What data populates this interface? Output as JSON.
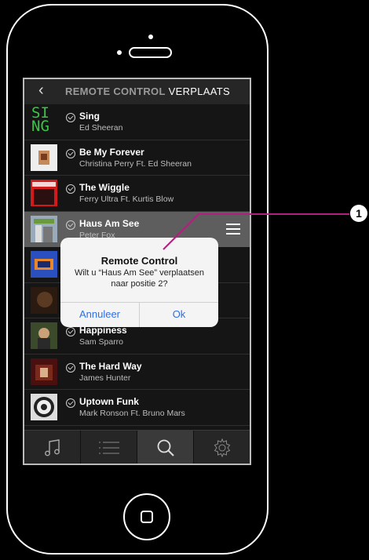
{
  "header": {
    "back_icon": "chevron-left-icon",
    "title_dim": "REMOTE CONTROL",
    "title_bright": "VERPLAATS"
  },
  "tracks": [
    {
      "title": "Sing",
      "artist": "Ed Sheeran",
      "art": "SI NG"
    },
    {
      "title": "Be My Forever",
      "artist": "Christina Perry Ft. Ed Sheeran"
    },
    {
      "title": "The Wiggle",
      "artist": "Ferry Ultra Ft. Kurtis Blow"
    },
    {
      "title": "Haus Am See",
      "artist": "Peter Fox",
      "selected": true
    },
    {
      "title": "",
      "artist": ""
    },
    {
      "title": "",
      "artist": ""
    },
    {
      "title": "Happiness",
      "artist": "Sam Sparro"
    },
    {
      "title": "The Hard Way",
      "artist": "James Hunter"
    },
    {
      "title": "Uptown Funk",
      "artist": "Mark Ronson Ft. Bruno Mars"
    }
  ],
  "dialog": {
    "title": "Remote Control",
    "message_line1": "Wilt u “Haus Am See” verplaatsen",
    "message_line2": "naar positie 2?",
    "cancel": "Annuleer",
    "ok": "Ok"
  },
  "tabs": [
    "music-note-icon",
    "list-icon",
    "search-icon",
    "settings-gear-icon"
  ],
  "callout": {
    "label": "1",
    "line_color": "#b0207e"
  },
  "colors": {
    "accent_green": "#3fc24b",
    "dialog_button": "#2d6fe6",
    "selected_row": "#5e5e5e"
  }
}
